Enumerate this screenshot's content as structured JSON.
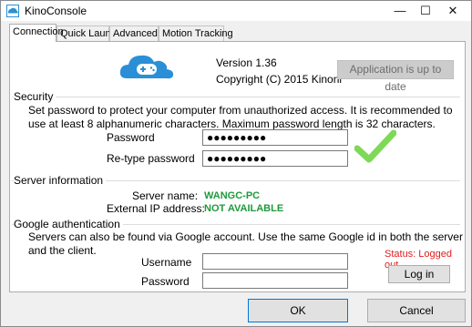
{
  "window": {
    "title": "KinoConsole",
    "controls": {
      "minimize": "—",
      "maximize": "☐",
      "close": "✕"
    }
  },
  "tabs": [
    {
      "label": "Connection",
      "active": true
    },
    {
      "label": "Quick Launch",
      "active": false
    },
    {
      "label": "Advanced",
      "active": false
    },
    {
      "label": "Motion Tracking",
      "active": false
    }
  ],
  "about": {
    "version": "Version 1.36",
    "copyright": "Copyright (C) 2015 Kinoni",
    "update_button": "Application is up to date"
  },
  "security": {
    "title": "Security",
    "description": "Set password to protect your computer from unauthorized access. It is recommended to use at least 8 alphanumeric characters. Maximum password length is 32 characters.",
    "password_label": "Password",
    "password_value": "●●●●●●●●●",
    "retype_label": "Re-type password",
    "retype_value": "●●●●●●●●●"
  },
  "server": {
    "title": "Server information",
    "name_label": "Server name:",
    "name_value": "WANGC-PC",
    "ip_label": "External IP address:",
    "ip_value": "NOT AVAILABLE"
  },
  "google": {
    "title": "Google authentication",
    "description": "Servers can also be found via Google account. Use the same Google id in both the server and the client.",
    "status": "Status: Logged out",
    "username_label": "Username",
    "username_value": "",
    "password_label": "Password",
    "password_value": "",
    "login_button": "Log in"
  },
  "footer": {
    "ok_button": "OK",
    "cancel_button": "Cancel"
  },
  "colors": {
    "success_green": "#1e9a3b",
    "status_red": "#e21d1d",
    "accent_blue": "#0078d7",
    "logo_blue": "#2a8fd6"
  }
}
